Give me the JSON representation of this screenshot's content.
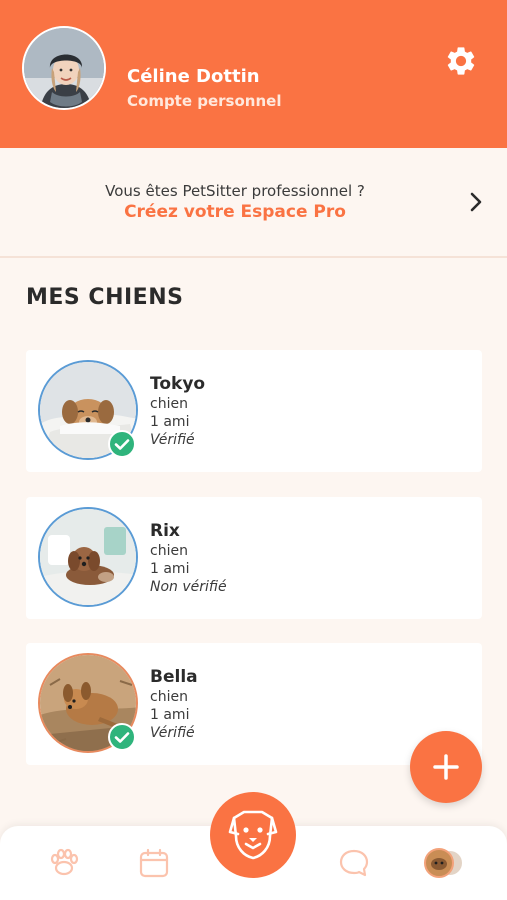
{
  "colors": {
    "accent": "#fa7343",
    "verified": "#2fb47c",
    "nav_icon": "#fbc3ad"
  },
  "profile": {
    "name": "Céline Dottin",
    "account_type": "Compte personnel",
    "settings_icon": "gear-icon"
  },
  "pro_banner": {
    "question": "Vous êtes PetSitter professionnel ?",
    "link": "Créez votre Espace Pro",
    "icon": "chevron-right-icon"
  },
  "section_title": "MES CHIENS",
  "dogs": [
    {
      "name": "Tokyo",
      "type": "chien",
      "friends": "1 ami",
      "status": "Vérifié",
      "verified": true
    },
    {
      "name": "Rix",
      "type": "chien",
      "friends": "1 ami",
      "status": "Non vérifié",
      "verified": false
    },
    {
      "name": "Bella",
      "type": "chien",
      "friends": "1 ami",
      "status": "Vérifié",
      "verified": true
    }
  ],
  "fab_icon": "plus-icon",
  "bottom_nav": {
    "items": [
      "paw-icon",
      "calendar-icon",
      "dog-face-icon",
      "chat-bubble-icon",
      "dogs-avatar"
    ]
  }
}
